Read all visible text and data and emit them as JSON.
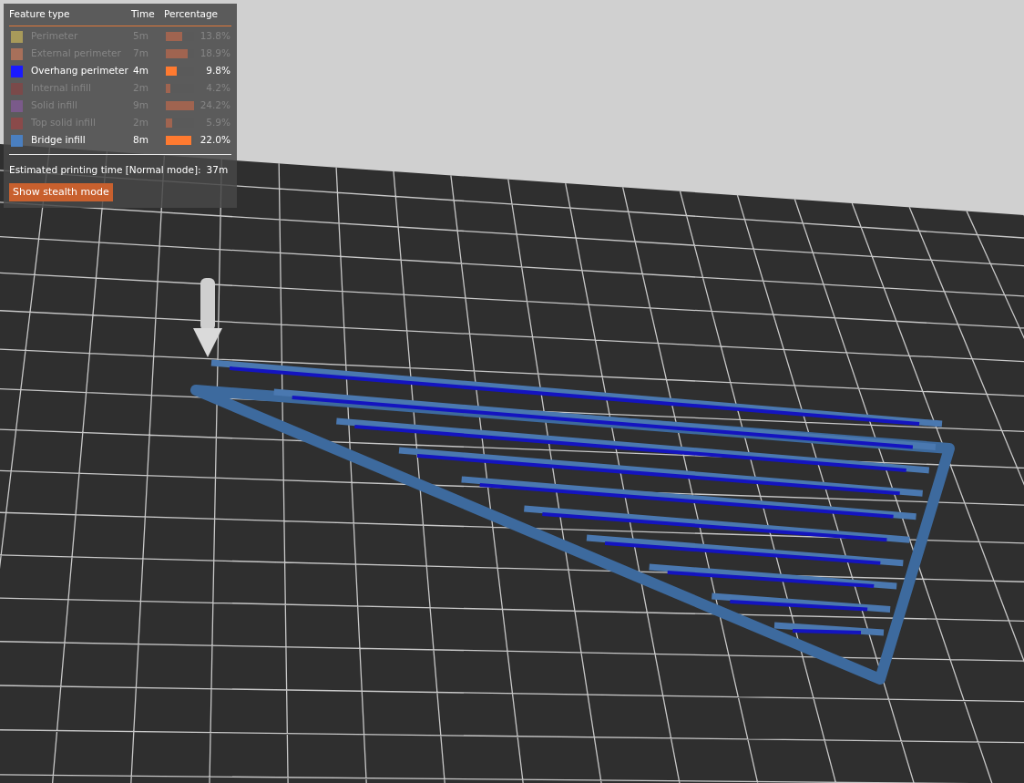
{
  "legend": {
    "columns": [
      "Feature type",
      "Time",
      "Percentage"
    ],
    "items": [
      {
        "name": "Perimeter",
        "time": "5m",
        "percentage": "13.8%",
        "level": 0.57,
        "color": "#a89a5a",
        "visible": false
      },
      {
        "name": "External perimeter",
        "time": "7m",
        "percentage": "18.9%",
        "level": 0.78,
        "color": "#a8705a",
        "visible": false
      },
      {
        "name": "Overhang perimeter",
        "time": "4m",
        "percentage": "9.8%",
        "level": 0.4,
        "color": "#1a1aff",
        "visible": true
      },
      {
        "name": "Internal infill",
        "time": "2m",
        "percentage": "4.2%",
        "level": 0.17,
        "color": "#7a4a4a",
        "visible": false
      },
      {
        "name": "Solid infill",
        "time": "9m",
        "percentage": "24.2%",
        "level": 1.0,
        "color": "#7a5a8a",
        "visible": false
      },
      {
        "name": "Top solid infill",
        "time": "2m",
        "percentage": "5.9%",
        "level": 0.24,
        "color": "#8a4a4a",
        "visible": false
      },
      {
        "name": "Bridge infill",
        "time": "8m",
        "percentage": "22.0%",
        "level": 0.91,
        "color": "#4a7fc0",
        "visible": true
      }
    ],
    "estimate_label": "Estimated printing time [Normal mode]:",
    "estimate_value": "37m",
    "stealth_button": "Show stealth mode"
  }
}
